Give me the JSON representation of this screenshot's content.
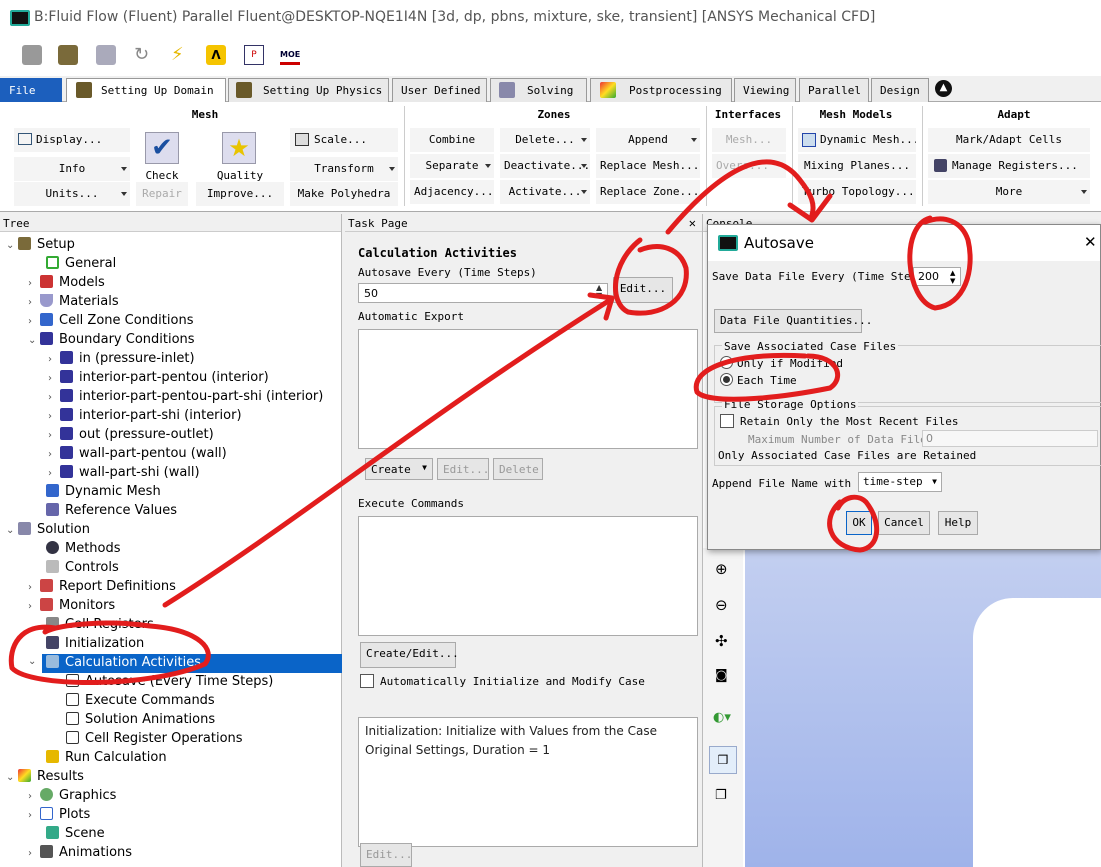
{
  "window": {
    "title": "B:Fluid Flow (Fluent) Parallel Fluent@DESKTOP-NQE1I4N  [3d, dp, pbns, mixture, ske, transient] [ANSYS Mechanical CFD]"
  },
  "toolbar": {
    "icons": [
      "cube-icon",
      "mesh-check-icon",
      "grid-icon",
      "refresh-icon",
      "lightning-icon",
      "lambda-icon",
      "parallel-icon",
      "moe-icon"
    ],
    "lambda_glyph": "Λ",
    "moe_glyph": "MOE"
  },
  "tabs": [
    "File",
    "Setting Up Domain",
    "Setting Up Physics",
    "User Defined",
    "Solving",
    "Postprocessing",
    "Viewing",
    "Parallel",
    "Design"
  ],
  "ribbon": {
    "mesh": {
      "header": "Mesh",
      "display": "Display...",
      "info": "Info",
      "units": "Units...",
      "check": "Check",
      "repair": "Repair",
      "quality": "Quality",
      "improve": "Improve...",
      "scale": "Scale...",
      "transform": "Transform",
      "polyhedra": "Make Polyhedra"
    },
    "zones": {
      "header": "Zones",
      "combine": "Combine",
      "separate": "Separate",
      "adjacency": "Adjacency...",
      "delete": "Delete...",
      "deactivate": "Deactivate...",
      "activate": "Activate...",
      "append": "Append",
      "replace_mesh": "Replace Mesh...",
      "replace_zone": "Replace Zone..."
    },
    "interfaces": {
      "header": "Interfaces",
      "mesh": "Mesh...",
      "overset": "Overs..."
    },
    "mesh_models": {
      "header": "Mesh Models",
      "dynamic": "Dynamic Mesh...",
      "mixing": "Mixing Planes...",
      "turbo": "Turbo Topology..."
    },
    "adapt": {
      "header": "Adapt",
      "mark": "Mark/Adapt Cells",
      "manage": "Manage Registers...",
      "more": "More"
    }
  },
  "tree": {
    "header": "Tree",
    "items": [
      "Setup",
      "General",
      "Models",
      "Materials",
      "Cell Zone Conditions",
      "Boundary Conditions",
      "in (pressure-inlet)",
      "interior-part-pentou (interior)",
      "interior-part-pentou-part-shi (interior)",
      "interior-part-shi (interior)",
      "out (pressure-outlet)",
      "wall-part-pentou (wall)",
      "wall-part-shi (wall)",
      "Dynamic Mesh",
      "Reference Values",
      "Solution",
      "Methods",
      "Controls",
      "Report Definitions",
      "Monitors",
      "Cell Registers",
      "Initialization",
      "Calculation Activities",
      "Autosave (Every Time Steps)",
      "Execute Commands",
      "Solution Animations",
      "Cell Register Operations",
      "Run Calculation",
      "Results",
      "Graphics",
      "Plots",
      "Scene",
      "Animations"
    ]
  },
  "task": {
    "header": "Task Page",
    "title": "Calculation Activities",
    "autosave_label": "Autosave Every (Time Steps)",
    "autosave_value": "50",
    "edit": "Edit...",
    "auto_export": "Automatic Export",
    "create": "Create",
    "edit_disabled": "Edit...",
    "delete": "Delete",
    "exec_commands": "Execute Commands",
    "create_edit": "Create/Edit...",
    "auto_init": "Automatically Initialize and Modify Case",
    "init_info": "Initialization: Initialize with Values from the Case Original Settings, Duration = 1",
    "bottom_edit": "Edit..."
  },
  "console": {
    "header": "Console"
  },
  "dialog": {
    "title": "Autosave",
    "close": "✕",
    "save_every_label": "Save Data File Every (Time Steps)",
    "save_every_value": "200",
    "data_quantities": "Data File Quantities...",
    "assoc_case": "Save Associated Case Files",
    "only_modified": "Only if Modified",
    "each_time": "Each Time",
    "storage": "File Storage Options",
    "retain": "Retain Only the Most Recent Files",
    "max_num_label": "Maximum Number of Data Files",
    "max_num_value": "0",
    "only_assoc": "Only Associated Case Files are Retained",
    "append_label": "Append File Name with",
    "append_value": "time-step",
    "ok": "OK",
    "cancel": "Cancel",
    "help": "Help"
  },
  "colors": {
    "accent": "#0a64c8",
    "annotation": "#e21d1d"
  }
}
